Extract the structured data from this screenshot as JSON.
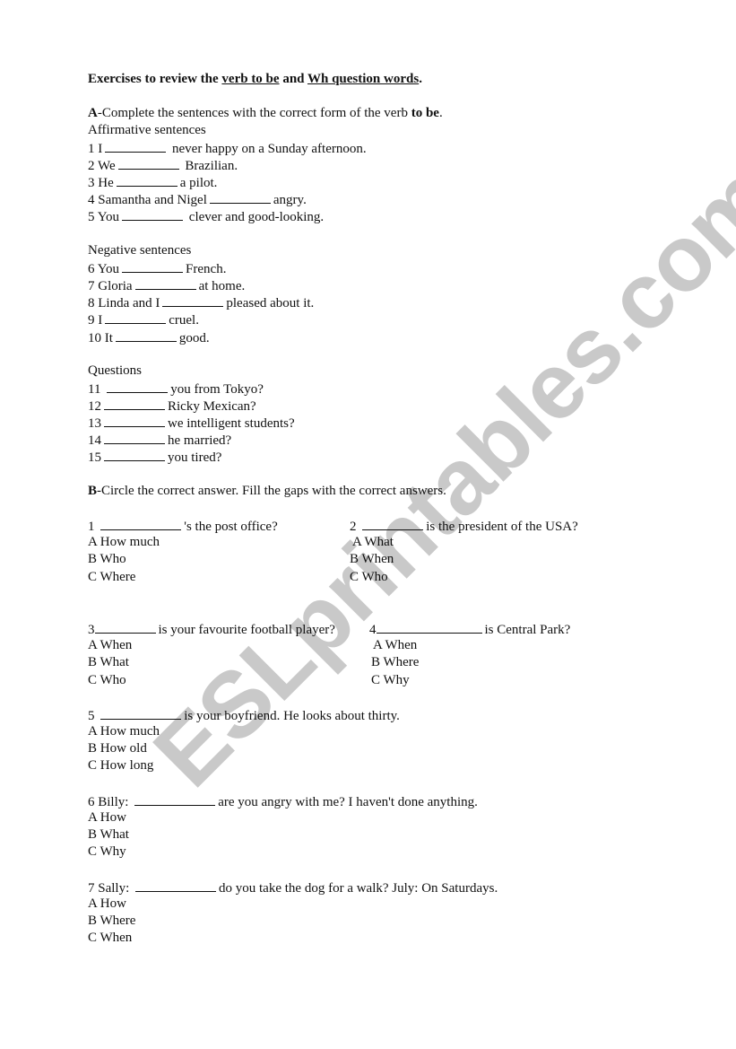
{
  "title": {
    "prefix": "Exercises to review the ",
    "link1": "verb to be",
    "middle": " and ",
    "link2": "Wh question words",
    "suffix": "."
  },
  "sectionA": {
    "letter": "A",
    "instruction_pre": "-Complete the sentences with the correct form of the verb ",
    "instruction_bold": "to be",
    "instruction_post": ".",
    "groups": [
      {
        "heading": "Affirmative sentences",
        "items": [
          {
            "num": "1",
            "before": "I",
            "after": "never happy on a Sunday afternoon."
          },
          {
            "num": "2",
            "before": "We",
            "after": "Brazilian."
          },
          {
            "num": "3",
            "before": "He",
            "after": "a pilot."
          },
          {
            "num": "4",
            "before": "Samantha and Nigel",
            "after": "angry."
          },
          {
            "num": "5",
            "before": "You",
            "after": "clever and good-looking."
          }
        ]
      },
      {
        "heading": "Negative sentences",
        "items": [
          {
            "num": "6",
            "before": "You",
            "after": "French."
          },
          {
            "num": "7",
            "before": "Gloria",
            "after": "at home."
          },
          {
            "num": "8",
            "before": "Linda and I",
            "after": "pleased about it."
          },
          {
            "num": "9",
            "before": "I",
            "after": "cruel."
          },
          {
            "num": "10",
            "before": "It",
            "after": "good."
          }
        ]
      },
      {
        "heading": "Questions",
        "items": [
          {
            "num": "11",
            "before": "",
            "after": "you from Tokyo?"
          },
          {
            "num": "12",
            "before": "",
            "after": "Ricky Mexican?"
          },
          {
            "num": "13",
            "before": "",
            "after": "we intelligent students?"
          },
          {
            "num": "14",
            "before": "",
            "after": "he married?"
          },
          {
            "num": "15",
            "before": "",
            "after": "you tired?"
          }
        ]
      }
    ]
  },
  "sectionB": {
    "letter": "B",
    "instruction": "-Circle the correct answer. Fill the gaps with the correct answers.",
    "questions": [
      {
        "num": "1",
        "before": "",
        "after": "'s the post office?",
        "options": [
          "A How much",
          "B Who",
          "C Where"
        ]
      },
      {
        "num": "2",
        "before": "",
        "after": "is the president of the USA?",
        "options": [
          "A What",
          "B When",
          "C Who"
        ]
      },
      {
        "num": "3",
        "before": "",
        "after": "is your favourite football player?",
        "options": [
          "A When",
          "B What",
          "C Who"
        ]
      },
      {
        "num": "4",
        "before": "",
        "after": "is Central Park?",
        "options": [
          "A When",
          "B Where",
          "C Why"
        ]
      },
      {
        "num": "5",
        "before": "",
        "after": "is your boyfriend. He looks about thirty.",
        "options": [
          "A How much",
          "B How old",
          "C How long"
        ]
      },
      {
        "num": "6",
        "before": "Billy:",
        "after": "are you angry with me? I haven't done anything.",
        "options": [
          "A How",
          "B What",
          "C Why"
        ]
      },
      {
        "num": "7",
        "before": "Sally:",
        "after": "do you take the dog for a walk?  July: On Saturdays.",
        "options": [
          "A How",
          "B Where",
          "C When"
        ]
      }
    ]
  },
  "watermark": "ESLprintables.com"
}
